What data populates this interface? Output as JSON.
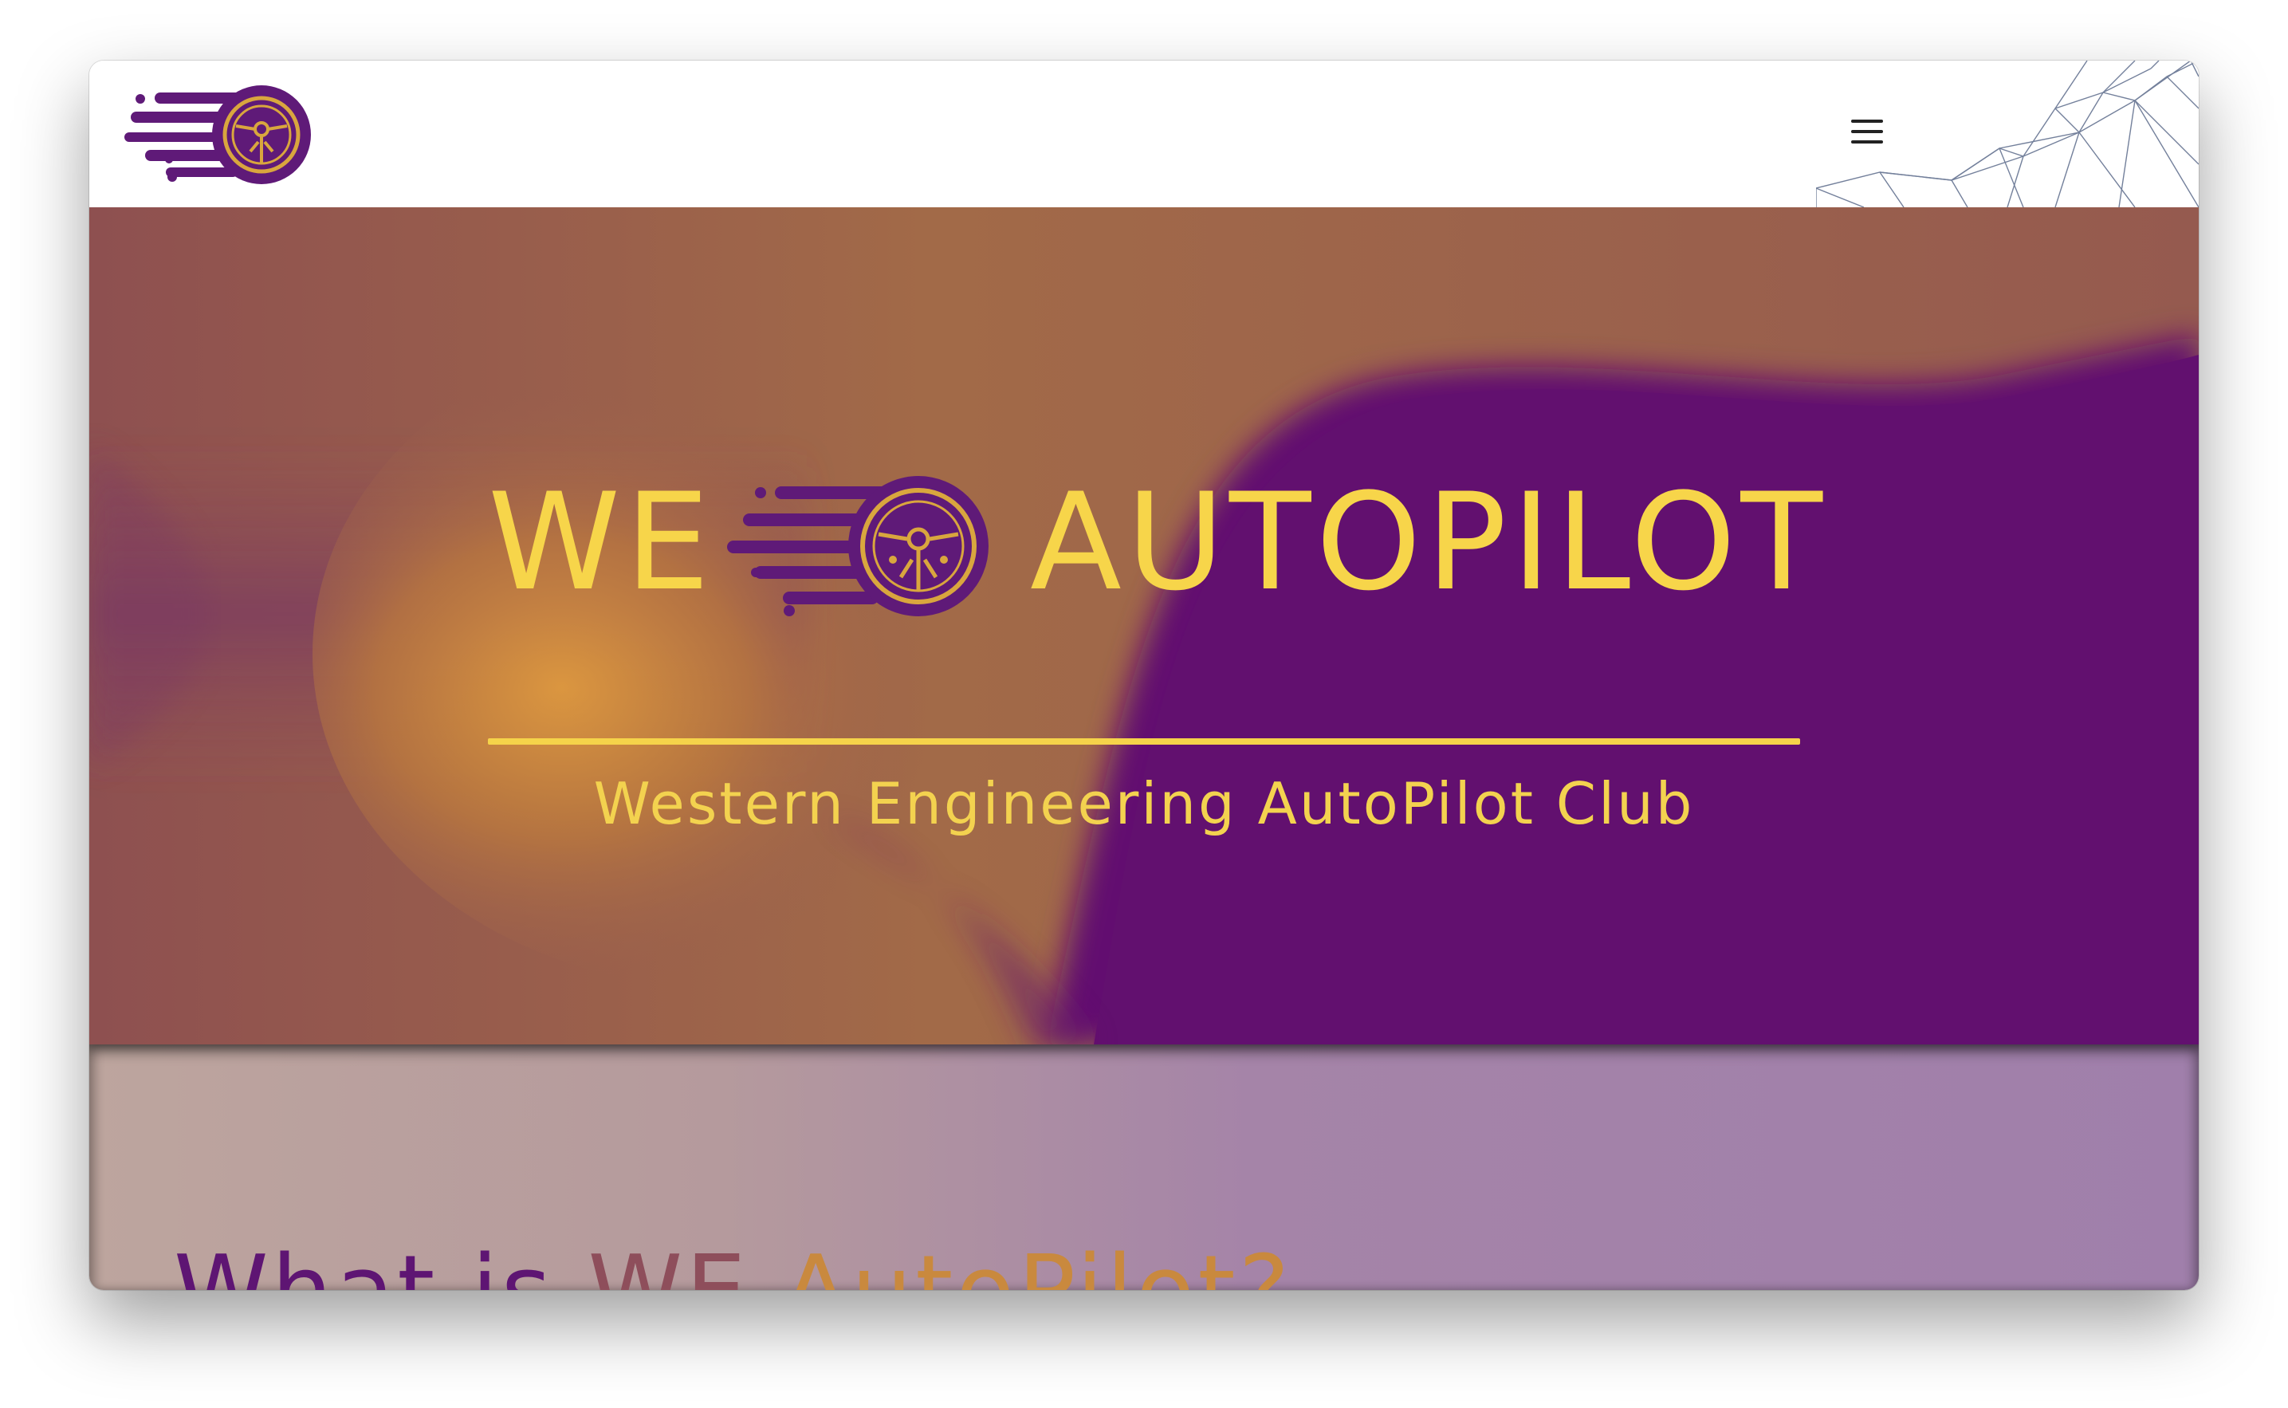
{
  "nav": {
    "logo_name": "we-autopilot-logo",
    "menu_icon": "hamburger-menu-icon"
  },
  "hero": {
    "title_left": "WE",
    "title_right": "AUTOPILOT",
    "subtitle": "Western Engineering AutoPilot Club"
  },
  "about": {
    "heading_part1": "What is ",
    "heading_part2": "WE ",
    "heading_part3": "AutoPilot?"
  },
  "colors": {
    "purple": "#5f106f",
    "gold": "#f7d54a",
    "orange_brown": "#a0694a"
  }
}
